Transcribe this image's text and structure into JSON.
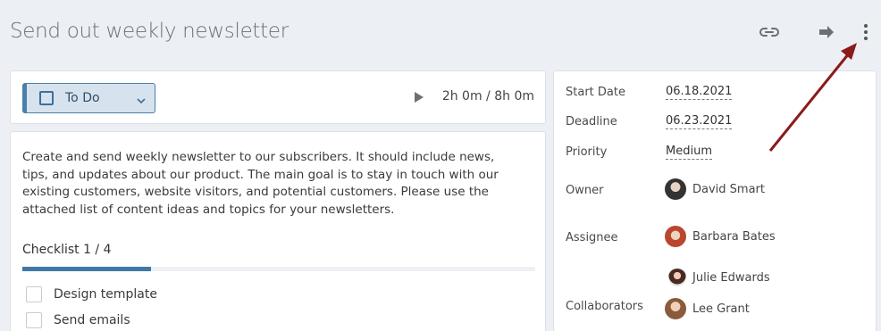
{
  "task": {
    "title": "Send out weekly newsletter"
  },
  "header": {
    "icons": [
      "link-icon",
      "forward-icon",
      "more-vertical-icon"
    ]
  },
  "status": {
    "label": "To Do",
    "color": "#4a7fa8"
  },
  "timer": {
    "text": "2h 0m / 8h 0m"
  },
  "description": "Create and send weekly newsletter to our subscribers. It should include news, tips, and updates about our product. The main goal is to stay in touch with our existing customers, website visitors, and potential customers. Please use the attached list of content ideas and topics for your newsletters.",
  "checklist": {
    "title": "Checklist 1 / 4",
    "progress": 0.25,
    "items": [
      {
        "label": "Design template",
        "checked": false
      },
      {
        "label": "Send emails",
        "checked": false
      }
    ]
  },
  "fields": {
    "start_date_label": "Start Date",
    "start_date": "06.18.2021",
    "deadline_label": "Deadline",
    "deadline": "06.23.2021",
    "priority_label": "Priority",
    "priority": "Medium",
    "owner_label": "Owner",
    "owner": "David Smart",
    "assignee_label": "Assignee",
    "assignee": "Barbara Bates",
    "collaborators_label": "Collaborators",
    "collaborators": [
      "Julie Edwards",
      "Lee Grant"
    ]
  },
  "annotation": {
    "arrow_color": "#8b1a1a"
  }
}
